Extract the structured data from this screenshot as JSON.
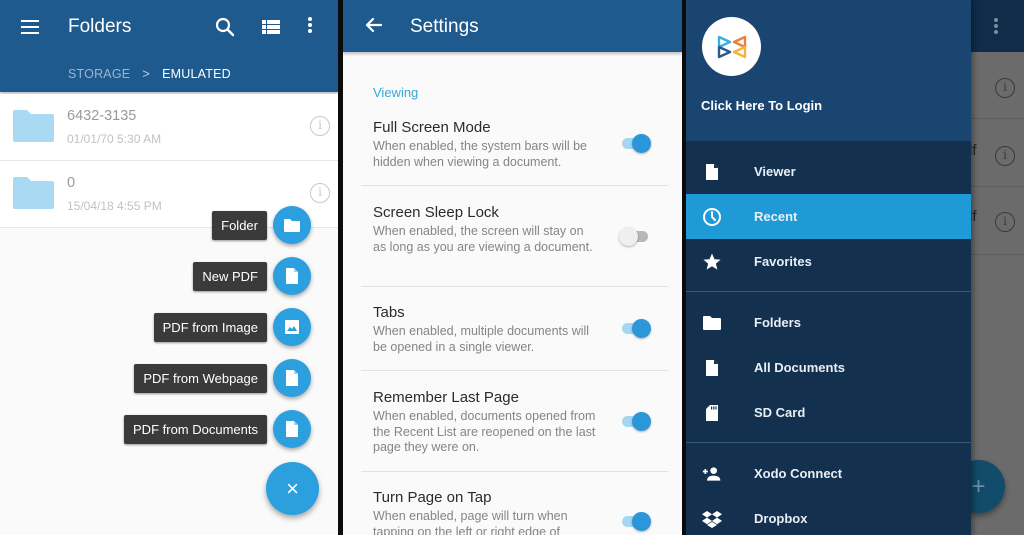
{
  "folders_screen": {
    "title": "Folders",
    "breadcrumb": [
      "STORAGE",
      "EMULATED"
    ],
    "breadcrumb_separator": ">",
    "rows": [
      {
        "name": "6432-3135",
        "date": "01/01/70 5:30 AM"
      },
      {
        "name": "0",
        "date": "15/04/18 4:55 PM"
      }
    ],
    "fab_menu": [
      {
        "label": "Folder",
        "icon": "folder-icon"
      },
      {
        "label": "New PDF",
        "icon": "document-icon"
      },
      {
        "label": "PDF from Image",
        "icon": "image-icon"
      },
      {
        "label": "PDF from Webpage",
        "icon": "document-icon"
      },
      {
        "label": "PDF from Documents",
        "icon": "document-icon"
      }
    ],
    "fab_close": "×",
    "info_glyph": "i"
  },
  "settings_screen": {
    "title": "Settings",
    "section": "Viewing",
    "items": [
      {
        "title": "Full Screen Mode",
        "desc": "When enabled, the system bars will be hidden when viewing a document.",
        "enabled": true
      },
      {
        "title": "Screen Sleep Lock",
        "desc": "When enabled, the screen will stay on as long as you are viewing a document.",
        "enabled": false
      },
      {
        "title": "Tabs",
        "desc": "When enabled, multiple documents will be opened in a single viewer.",
        "enabled": true
      },
      {
        "title": "Remember Last Page",
        "desc": "When enabled, documents opened from the Recent List are reopened on the last page they were on.",
        "enabled": true
      },
      {
        "title": "Turn Page on Tap",
        "desc": "When enabled, page will turn when tapping on the left or right edge of",
        "enabled": true
      }
    ]
  },
  "drawer_screen": {
    "login": "Click Here To Login",
    "items": [
      {
        "label": "Viewer",
        "icon": "document-icon",
        "active": false
      },
      {
        "label": "Recent",
        "icon": "clock-icon",
        "active": true
      },
      {
        "label": "Favorites",
        "icon": "star-icon",
        "active": false
      },
      {
        "label": "Folders",
        "icon": "folder-icon",
        "active": false
      },
      {
        "label": "All Documents",
        "icon": "document-icon",
        "active": false
      },
      {
        "label": "SD Card",
        "icon": "sd-card-icon",
        "active": false
      },
      {
        "label": "Xodo Connect",
        "icon": "add-user-icon",
        "active": false
      },
      {
        "label": "Dropbox",
        "icon": "dropbox-icon",
        "active": false
      }
    ],
    "background_rows": [
      {
        "ext": ""
      },
      {
        "ext": "df"
      },
      {
        "ext": "df"
      }
    ],
    "bg_fab": "+",
    "info_glyph": "i"
  },
  "colors": {
    "appbar": "#1f5a8f",
    "accent": "#2c9fdf",
    "drawer_bg": "#14304f",
    "drawer_header": "#1a4571",
    "drawer_active": "#1e9ad6",
    "section_label": "#3aa7d9"
  }
}
